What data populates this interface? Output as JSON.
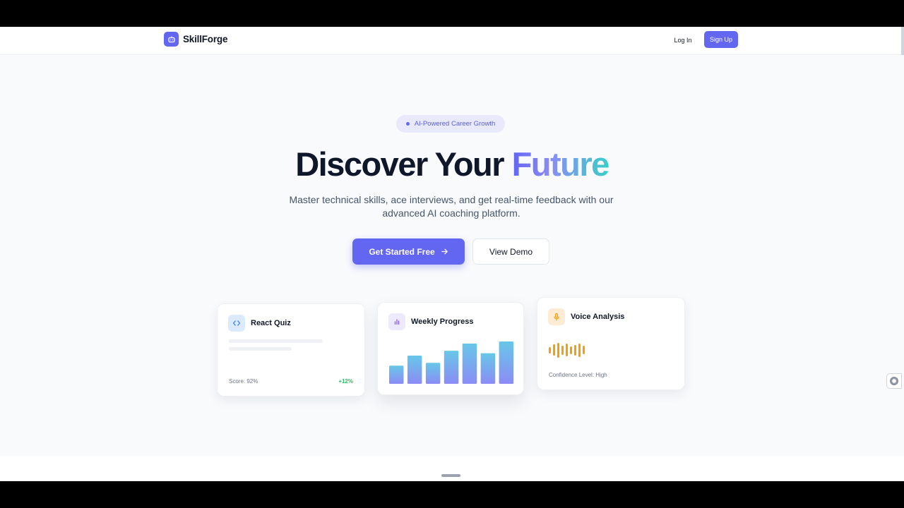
{
  "brand": {
    "name": "SkillForge"
  },
  "nav": {
    "login_label": "Log In",
    "signup_label": "Sign Up"
  },
  "hero": {
    "badge": "AI-Powered Career Growth",
    "title_plain": "Discover Your",
    "title_highlight": "Future",
    "subtitle": "Master technical skills, ace interviews, and get real-time feedback with our advanced AI coaching platform.",
    "primary_cta": "Get Started Free",
    "secondary_cta": "View Demo"
  },
  "cards": {
    "quiz": {
      "title": "React Quiz",
      "score": "Score: 92%",
      "delta": "+12%",
      "icon": "code-icon"
    },
    "progress": {
      "title": "Weekly Progress",
      "icon": "bar-chart-icon",
      "bar_levels": [
        0.45,
        0.7,
        0.52,
        0.82,
        1.0,
        0.76,
        1.05
      ]
    },
    "voice": {
      "title": "Voice Analysis",
      "confidence": "Confidence Level: High",
      "icon": "microphone-icon"
    }
  },
  "colors": {
    "accent": "#6366f1",
    "gradient_end": "#38cfc7",
    "success": "#22c55e",
    "voice": "#f59e0b"
  }
}
